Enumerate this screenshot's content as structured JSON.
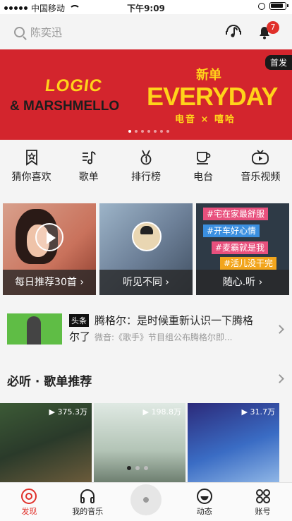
{
  "status_bar": {
    "carrier": "中国移动",
    "time": "下午9:09"
  },
  "header": {
    "search_placeholder": "陈奕迅",
    "notification_count": "7"
  },
  "banner": {
    "logic": "LOGIC",
    "marshmello": "& MARSHMELLO",
    "xindan": "新单",
    "everyday": "EVERYDAY",
    "genre": "电音 × 嘻哈",
    "tag": "首发",
    "page_count": 7,
    "active_page": 1
  },
  "entries": [
    {
      "label": "猜你喜欢",
      "icon": "bookmark-star-icon"
    },
    {
      "label": "歌单",
      "icon": "playlist-icon"
    },
    {
      "label": "排行榜",
      "icon": "medal-icon"
    },
    {
      "label": "电台",
      "icon": "radio-cup-icon"
    },
    {
      "label": "音乐视频",
      "icon": "tv-icon"
    }
  ],
  "cards": [
    {
      "caption": "每日推荐30首"
    },
    {
      "caption": "听见不同"
    },
    {
      "caption": "随心.听",
      "tags": [
        "#宅在家最舒服",
        "#开车好心情",
        "#麦霸就是我",
        "#活儿没干完"
      ]
    }
  ],
  "news": {
    "label": "头条",
    "title": "腾格尔：是时候重新认识一下腾格",
    "title_line2": "尔了",
    "subtitle": "微音:《歌手》节目组公布腾格尔即..."
  },
  "section": {
    "title": "必听 · 歌单推荐"
  },
  "playlists": [
    {
      "count": "▶ 375.3万"
    },
    {
      "count": "▶ 198.8万"
    },
    {
      "count": "▶ 31.7万"
    }
  ],
  "tabbar": [
    {
      "label": "发现",
      "active": true
    },
    {
      "label": "我的音乐",
      "active": false
    },
    {
      "label": "",
      "active": false
    },
    {
      "label": "动态",
      "active": false
    },
    {
      "label": "账号",
      "active": false
    }
  ],
  "colors": {
    "accent": "#e0302a",
    "banner_red": "#d3252d",
    "banner_yellow": "#ffd31a"
  }
}
